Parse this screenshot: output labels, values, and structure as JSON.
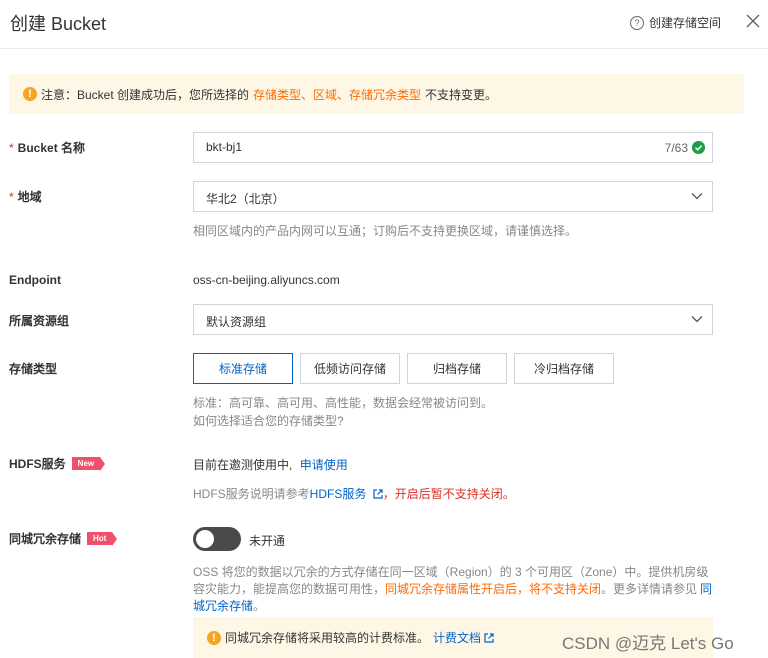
{
  "header": {
    "title": "创建 Bucket",
    "help_label": "创建存储空间"
  },
  "notice": {
    "prefix": "注意：Bucket 创建成功后，您所选择的",
    "highlight": "存储类型、区域、存储冗余类型",
    "suffix": "不支持变更。"
  },
  "bucket_name": {
    "label": "Bucket 名称",
    "value": "bkt-bj1",
    "counter": "7/63"
  },
  "region": {
    "label": "地域",
    "value": "华北2（北京）",
    "hint": "相同区域内的产品内网可以互通；订购后不支持更换区域，请谨慎选择。"
  },
  "endpoint": {
    "label": "Endpoint",
    "value": "oss-cn-beijing.aliyuncs.com"
  },
  "resource_group": {
    "label": "所属资源组",
    "value": "默认资源组"
  },
  "storage_type": {
    "label": "存储类型",
    "options": [
      "标准存储",
      "低频访问存储",
      "归档存储",
      "冷归档存储"
    ],
    "selected": "标准存储",
    "hint": "标准：高可靠、高可用、高性能，数据会经常被访问到。",
    "link": "如何选择适合您的存储类型?"
  },
  "hdfs": {
    "label": "HDFS服务",
    "badge": "New",
    "status": "目前在邀测使用中,",
    "apply_link": "申请使用",
    "desc_prefix": "HDFS服务说明请参考",
    "desc_link": "HDFS服务",
    "desc_suffix": "，开启后暂不支持关闭。"
  },
  "zone_redundancy": {
    "label": "同城冗余存储",
    "badge": "Hot",
    "toggle_label": "未开通",
    "enabled": false,
    "desc_prefix": "OSS 将您的数据以冗余的方式存储在同一区域（Region）的 3 个可用区（Zone）中。提供机房级容灾能力，能提高您的数据可用性，",
    "desc_highlight": "同城冗余存储属性开启后，将不支持关闭",
    "desc_middle": "。更多详情请参见",
    "desc_link": "同城冗余存储",
    "desc_end": "。",
    "note": "同城冗余存储将采用较高的计费标准。",
    "note_link": "计费文档"
  },
  "watermark": "CSDN @迈克 Let's Go",
  "colors": {
    "accent": "#0064c8",
    "warning": "#ff6a00",
    "danger": "#d93026",
    "success": "#1e9e48",
    "notice_bg": "#fff7e6",
    "badge": "#f0506e"
  }
}
